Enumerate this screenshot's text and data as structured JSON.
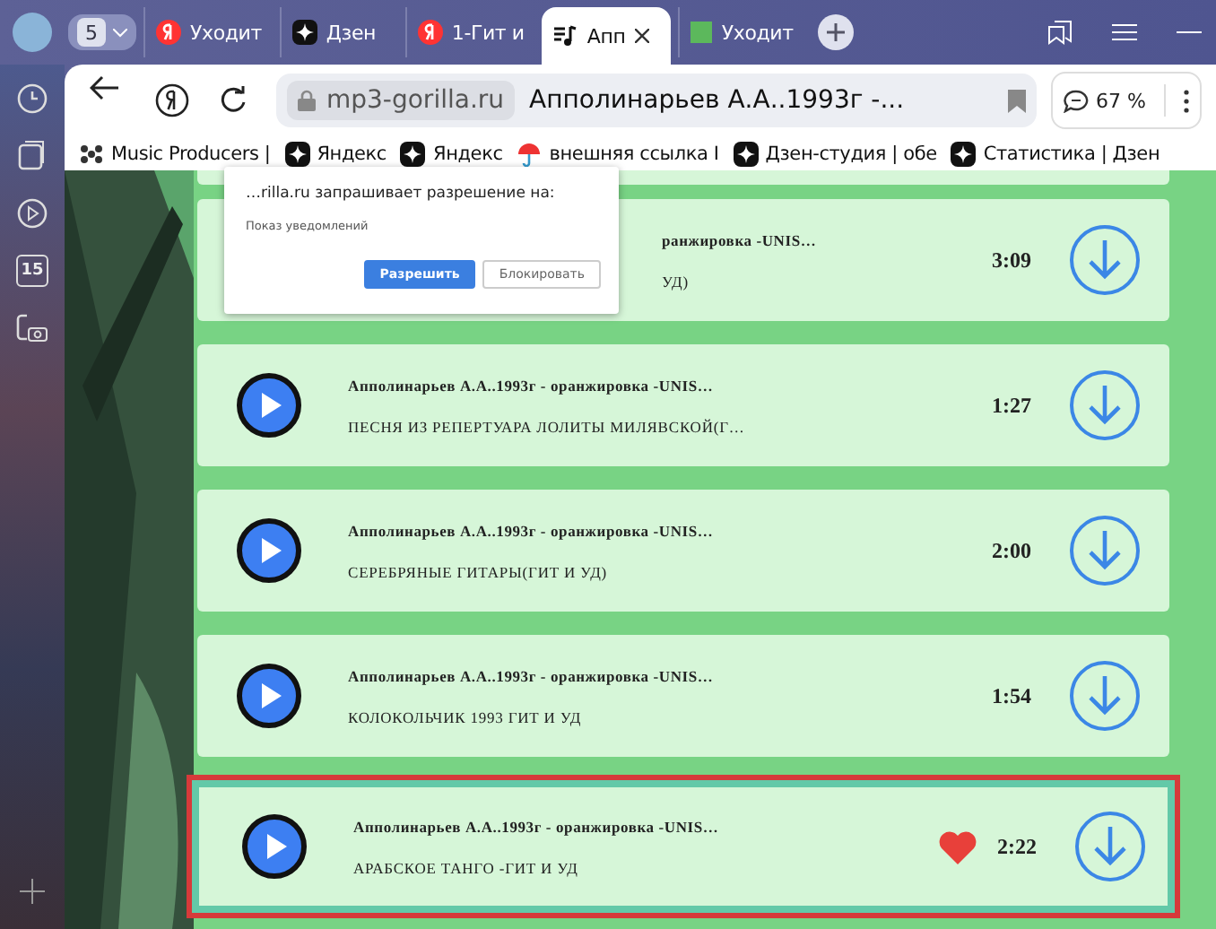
{
  "tab_bar": {
    "group_count": "5",
    "tabs": [
      {
        "label": "Уходит",
        "kind": "yandex",
        "selected": false
      },
      {
        "label": "Дзен",
        "kind": "zen",
        "selected": false
      },
      {
        "label": "1-Гит и",
        "kind": "yandex",
        "selected": false
      },
      {
        "label": "Апп",
        "kind": "music",
        "selected": true
      },
      {
        "label": "Уходит",
        "kind": "green",
        "selected": false
      }
    ]
  },
  "toolbar": {
    "domain": "mp3-gorilla.ru",
    "page_title": "Апполинарьев А.А..1993г -...",
    "zoom": "67 %"
  },
  "bookmarks": [
    {
      "label": "Music Producers |",
      "kind": "dots"
    },
    {
      "label": "Яндекс",
      "kind": "zen"
    },
    {
      "label": "Яндекс",
      "kind": "zen"
    },
    {
      "label": "внешняя ссылка I",
      "kind": "umbrella"
    },
    {
      "label": "Дзен-студия | обе",
      "kind": "zen"
    },
    {
      "label": "Статистика | Дзен",
      "kind": "zen"
    }
  ],
  "sidebar": {
    "calendar_day": "15"
  },
  "notification_popup": {
    "message": "…rilla.ru запрашивает разрешение на:",
    "detail": "Показ уведомлений",
    "buttons": [
      {
        "label": "Разрешить",
        "kind": "primary"
      },
      {
        "label": "Блокировать",
        "kind": "secondary"
      }
    ]
  },
  "tracks": [
    {
      "title": "ранжировка -UNIS…",
      "subtitle": "УД)",
      "duration": "3:09",
      "covered": true,
      "liked": false,
      "selected": false
    },
    {
      "title": "Апполинарьев А.А..1993г - оранжировка -UNIS…",
      "subtitle": "ПЕСНЯ ИЗ РЕПЕРТУАРА ЛОЛИТЫ МИЛЯВСКОЙ(Г…",
      "duration": "1:27",
      "covered": false,
      "liked": false,
      "selected": false
    },
    {
      "title": "Апполинарьев А.А..1993г - оранжировка -UNIS…",
      "subtitle": "СЕРЕБРЯНЫЕ ГИТАРЫ(ГИТ И УД)",
      "duration": "2:00",
      "covered": false,
      "liked": false,
      "selected": false
    },
    {
      "title": "Апполинарьев А.А..1993г - оранжировка -UNIS…",
      "subtitle": "КОЛОКОЛЬЧИК 1993 ГИТ И УД",
      "duration": "1:54",
      "covered": false,
      "liked": false,
      "selected": false
    },
    {
      "title": "Апполинарьев А.А..1993г - оранжировка -UNIS…",
      "subtitle": "АРАБСКОЕ ТАНГО -ГИТ И УД",
      "duration": "2:22",
      "covered": false,
      "liked": true,
      "selected": true
    }
  ]
}
